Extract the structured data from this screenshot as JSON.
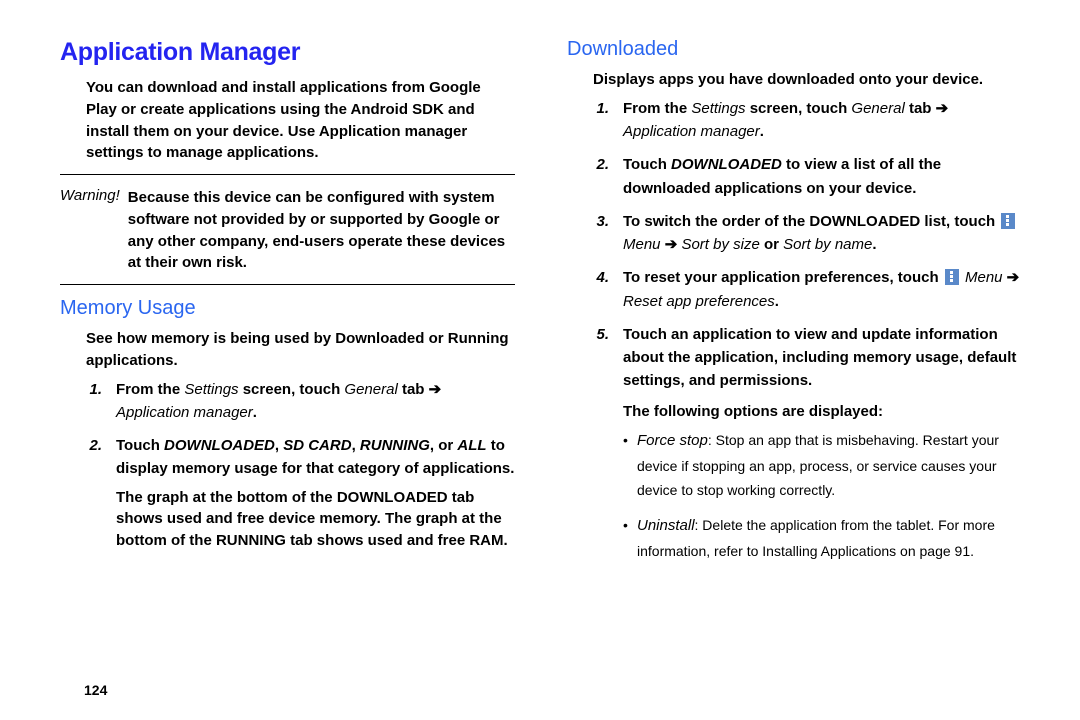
{
  "left": {
    "heading": "Application Manager",
    "intro": "You can download and install applications from Google Play or create applications using the Android SDK and install them on your device. Use Application manager settings to manage applications.",
    "warning_label": "Warning!",
    "warning_text": "Because this device can be configured with system software not provided by or supported by Google or any other company, end-users operate these devices at their own risk.",
    "memory_heading": "Memory Usage",
    "memory_intro": "See how memory is being used by Downloaded or Running applications.",
    "step1_num": "1.",
    "step1_a": "From the ",
    "step1_b": "Settings",
    "step1_c": " screen, touch ",
    "step1_d": "General",
    "step1_e": " tab ",
    "step1_arrow": "➔",
    "step1_f": "Application manager",
    "step1_g": ".",
    "step2_num": "2.",
    "step2_a": "Touch ",
    "step2_b": "DOWNLOADED",
    "step2_c": ", ",
    "step2_d": "SD CARD",
    "step2_e": ", ",
    "step2_f": "RUNNING",
    "step2_g": ", or ",
    "step2_h": "ALL",
    "step2_i": " to display memory usage for that category of applications.",
    "memory_note": "The graph at the bottom of the DOWNLOADED tab shows used and free device memory. The graph at the bottom of the RUNNING tab shows used and free RAM."
  },
  "right": {
    "heading": "Downloaded",
    "intro": "Displays apps you have downloaded onto your device.",
    "s1_num": "1.",
    "s1_a": "From the ",
    "s1_b": "Settings",
    "s1_c": " screen, touch ",
    "s1_d": "General",
    "s1_e": " tab ",
    "s1_arrow": "➔",
    "s1_f": "Application manager",
    "s1_g": ".",
    "s2_num": "2.",
    "s2_a": "Touch ",
    "s2_b": "DOWNLOADED",
    "s2_c": " to view a list of all the downloaded applications on your device.",
    "s3_num": "3.",
    "s3_a": "To switch the order of the DOWNLOADED list, touch ",
    "s3_menu": "Menu",
    "s3_arrow": " ➔ ",
    "s3_sort1": "Sort by size",
    "s3_or": " or ",
    "s3_sort2": "Sort by name",
    "s3_end": ".",
    "s4_num": "4.",
    "s4_a": "To reset your application preferences, touch ",
    "s4_menu": "Menu",
    "s4_arrow": " ➔ ",
    "s4_reset": "Reset app preferences",
    "s4_end": ".",
    "s5_num": "5.",
    "s5_a": "Touch an application to view and update information about the application, including memory usage, default settings, and permissions.",
    "opts_intro": "The following options are displayed:",
    "opt1_name": "Force stop",
    "opt1_text": ": Stop an app that is misbehaving. Restart your device if stopping an app, process, or service causes your device to stop working correctly.",
    "opt2_name": "Uninstall",
    "opt2_text_a": ": Delete the application from the tablet. For more information, refer to ",
    "opt2_xref": "Installing Applications",
    "opt2_text_b": " on page 91."
  },
  "page_number": "124"
}
